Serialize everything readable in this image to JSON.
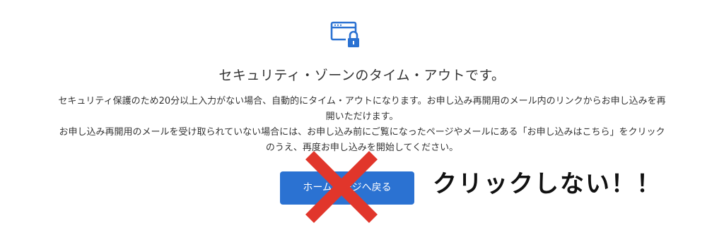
{
  "colors": {
    "accent": "#2b72d2",
    "cross": "#e1362b",
    "text": "#333333"
  },
  "icon": "browser-window-lock-icon",
  "title": "セキュリティ・ゾーンのタイム・アウトです。",
  "message": {
    "line1": "セキュリティ保護のため20分以上入力がない場合、自動的にタイム・アウトになります。お申し込み再開用のメール内のリンクからお申し込みを再",
    "line2": "開いただけます。",
    "line3": "お申し込み再開用のメールを受け取られていない場合には、お申し込み前にご覧になったページやメールにある「お申し込みはこちら」をクリック",
    "line4": "のうえ、再度お申し込みを開始してください。"
  },
  "home_button": {
    "label": "ホームページへ戻る"
  },
  "annotation": {
    "text": "クリックしない！！",
    "mark": "cross-mark"
  }
}
